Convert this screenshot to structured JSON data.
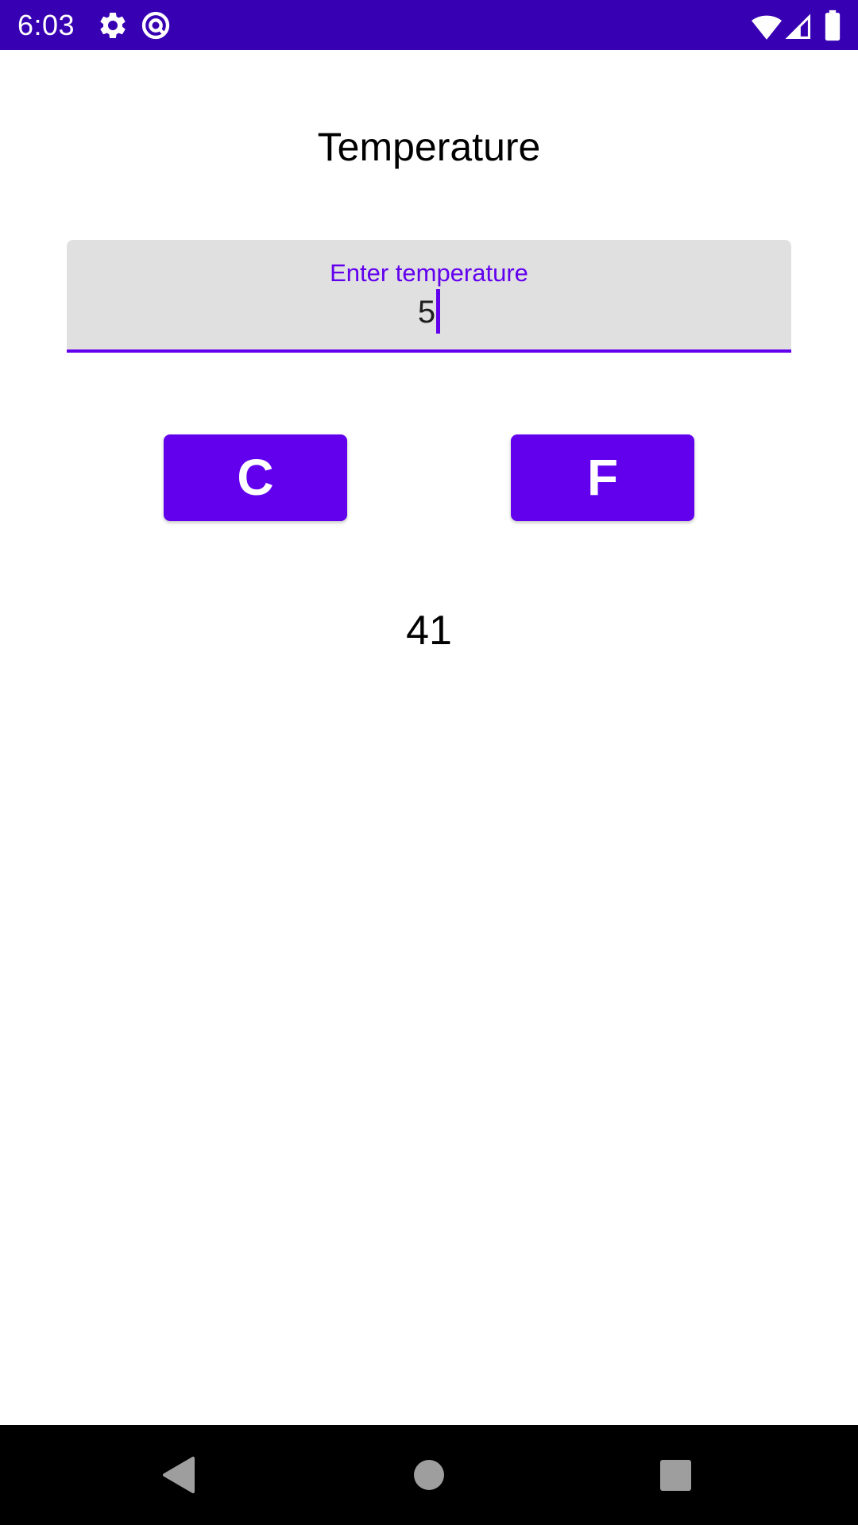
{
  "status_bar": {
    "time": "6:03",
    "background_color": "#3700b3",
    "icons": [
      "gear-icon",
      "sync-icon",
      "wifi-icon",
      "signal-icon",
      "battery-icon"
    ]
  },
  "screen": {
    "title": "Temperature"
  },
  "temperature_input": {
    "label": "Enter temperature",
    "value": "5",
    "accent_color": "#6200ee"
  },
  "buttons": {
    "celsius_label": "C",
    "fahrenheit_label": "F",
    "color": "#6200ee"
  },
  "result": {
    "value": "41"
  },
  "nav_bar": {
    "icons": [
      "back-icon",
      "home-icon",
      "recents-icon"
    ]
  }
}
